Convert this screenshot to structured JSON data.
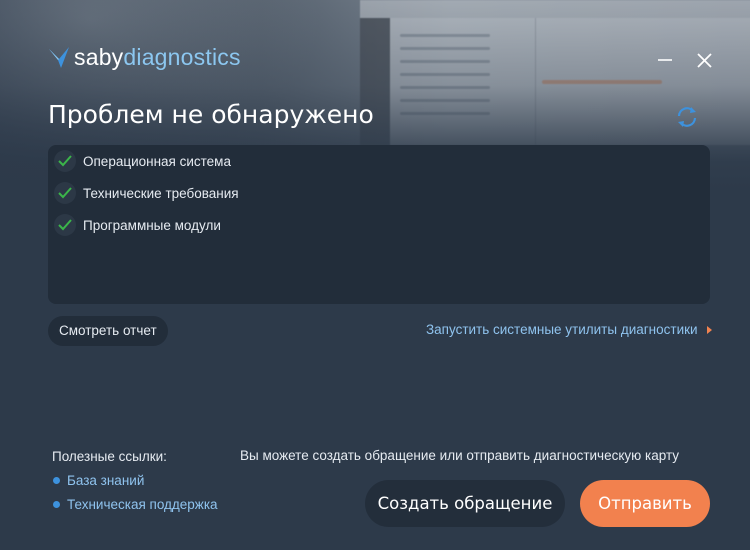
{
  "header": {
    "logo_part1": "saby",
    "logo_part2": "diagnostics",
    "title": "Проблем не обнаружено"
  },
  "checks": [
    {
      "label": "Операционная система",
      "status": "ok"
    },
    {
      "label": "Технические требования",
      "status": "ok"
    },
    {
      "label": "Программные модули",
      "status": "ok"
    }
  ],
  "actions": {
    "report_label": "Смотреть отчет",
    "utils_label": "Запустить системные утилиты диагностики"
  },
  "useful_links": {
    "title": "Полезные ссылки:",
    "items": [
      "База знаний",
      "Техническая поддержка"
    ]
  },
  "footer": {
    "hint": "Вы можете создать обращение или отправить диагностическую карту",
    "create_label": "Создать обращение",
    "send_label": "Отправить"
  },
  "icons": {
    "minimize": "minimize-icon",
    "close": "close-icon",
    "refresh": "refresh-icon",
    "check": "check-icon"
  },
  "colors": {
    "background": "#2d3a4a",
    "panel": "#222d3a",
    "accent_orange": "#f2814e",
    "link_blue": "#8fc3ee",
    "check_green": "#3bb54a"
  }
}
